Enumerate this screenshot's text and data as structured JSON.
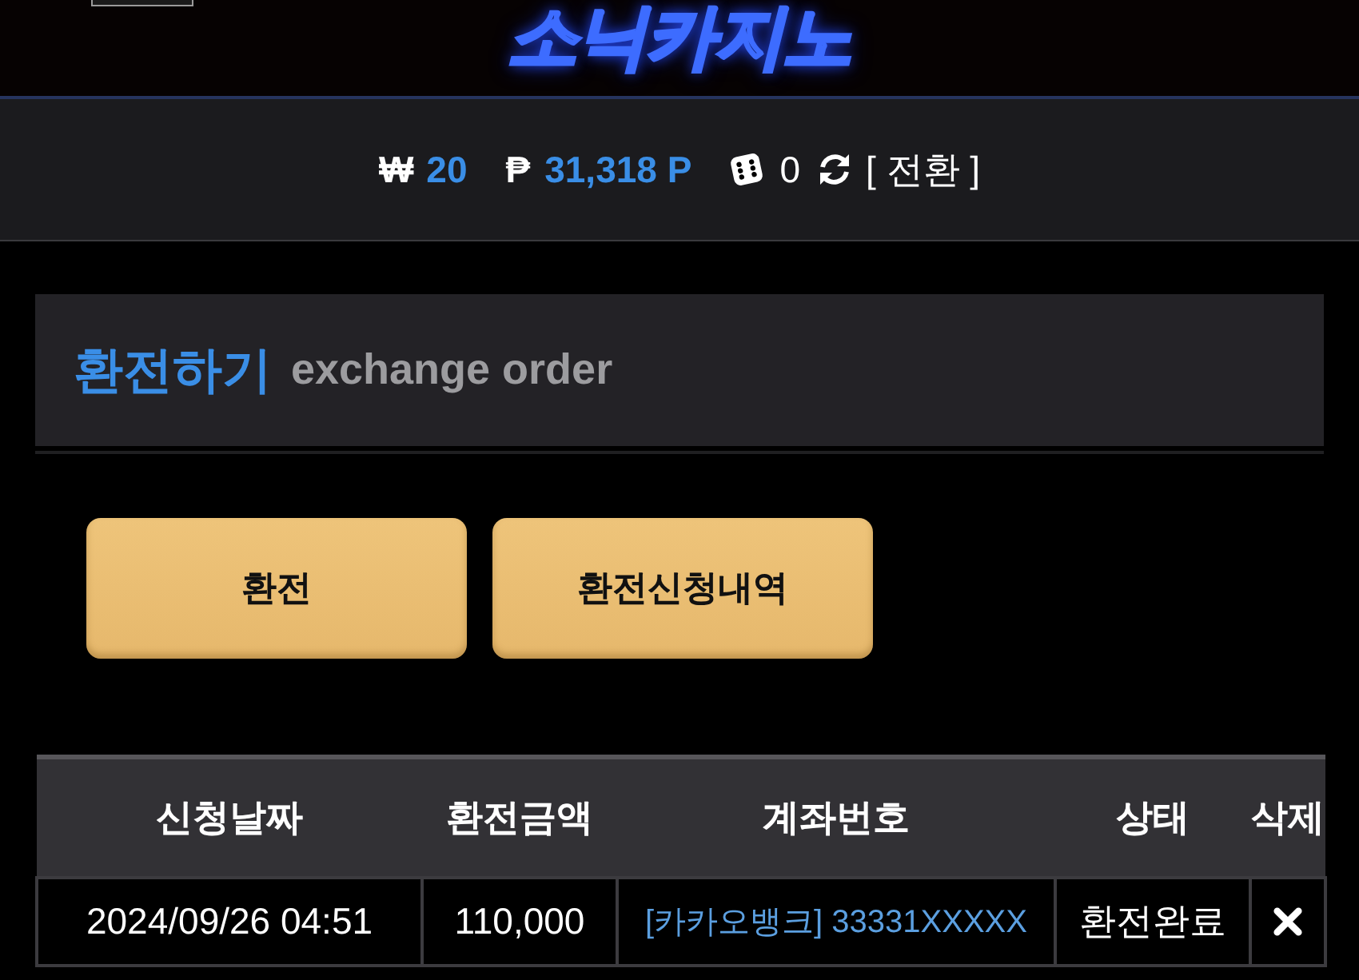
{
  "header": {
    "logo": "소닉카지노"
  },
  "balance_bar": {
    "won_symbol": "₩",
    "won": "20",
    "point_symbol": "₱",
    "points": "31,318 P",
    "dice": "0",
    "convert": "[ 전환 ]"
  },
  "panel": {
    "title": "환전하기",
    "subtitle": "exchange order"
  },
  "buttons": [
    {
      "label": "환전"
    },
    {
      "label": "환전신청내역"
    }
  ],
  "table": {
    "columns": [
      "신청날짜",
      "환전금액",
      "계좌번호",
      "상태",
      "삭제"
    ],
    "rows": [
      {
        "date": "2024/09/26 04:51",
        "amount": "110,000",
        "account": "[카카오뱅크] 33331XXXXX",
        "status": "환전완료"
      }
    ]
  }
}
